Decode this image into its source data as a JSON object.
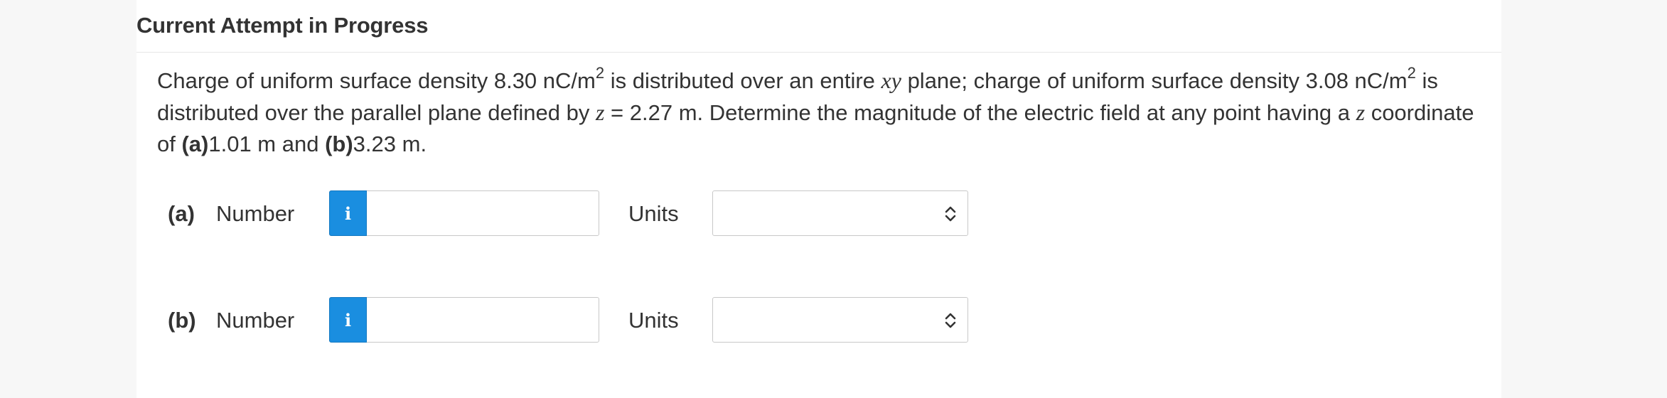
{
  "header": {
    "title": "Current Attempt in Progress"
  },
  "question": {
    "t1": "Charge of uniform surface density 8.30 nC/m",
    "sup1": "2",
    "t2": " is distributed over an entire ",
    "xy": "xy",
    "t3": " plane; charge of uniform surface density 3.08 nC/m",
    "sup2": "2",
    "t4": " is distributed over the parallel plane defined by ",
    "z1": "z",
    "t5": " = 2.27 m. Determine the magnitude of the electric field at any point having a ",
    "z2": "z",
    "t6": " coordinate of ",
    "a_label": "(a)",
    "t7": "1.01 m and ",
    "b_label": "(b)",
    "t8": "3.23 m."
  },
  "parts": {
    "a": {
      "label": "(a)",
      "number_label": "Number",
      "info_icon": "i",
      "number_value": "",
      "units_label": "Units",
      "units_value": ""
    },
    "b": {
      "label": "(b)",
      "number_label": "Number",
      "info_icon": "i",
      "number_value": "",
      "units_label": "Units",
      "units_value": ""
    }
  },
  "colors": {
    "info_button": "#1a8ee0",
    "text": "#333333",
    "border": "#c8c8c8"
  },
  "icons": {
    "info": "info-icon",
    "select_arrows": "chevron-up-down-icon"
  }
}
